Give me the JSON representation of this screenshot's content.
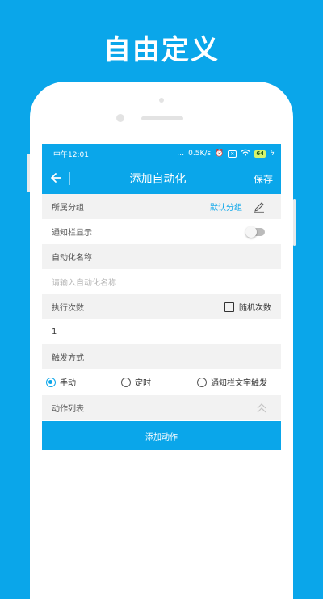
{
  "headline": "自由定义",
  "status_bar": {
    "time": "中午12:01",
    "speed": "0.5K/s",
    "battery": "64"
  },
  "app_bar": {
    "title": "添加自动化",
    "save_label": "保存"
  },
  "form": {
    "group": {
      "label": "所属分组",
      "value": "默认分组"
    },
    "notify": {
      "label": "通知栏显示",
      "enabled": false
    },
    "name": {
      "label": "自动化名称",
      "placeholder": "请输入自动化名称",
      "value": ""
    },
    "count": {
      "label": "执行次数",
      "random_label": "随机次数",
      "random_checked": false,
      "value": "1"
    },
    "trigger": {
      "label": "触发方式",
      "options": [
        "手动",
        "定时",
        "通知栏文字触发"
      ],
      "selected": "手动"
    },
    "actions": {
      "label": "动作列表"
    }
  },
  "add_action_label": "添加动作",
  "colors": {
    "accent": "#0aa6ea",
    "row_gray": "#f2f2f2"
  }
}
